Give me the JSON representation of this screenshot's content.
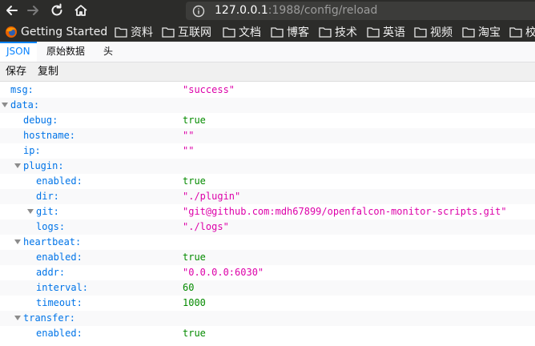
{
  "url": {
    "host": "127.0.0.1",
    "path": ":1988/config/reload"
  },
  "bookmarks": [
    {
      "label": "Getting Started",
      "icon": "firefox-icon"
    },
    {
      "label": "资料",
      "icon": "folder-icon"
    },
    {
      "label": "互联网",
      "icon": "folder-icon"
    },
    {
      "label": "文档",
      "icon": "folder-icon"
    },
    {
      "label": "博客",
      "icon": "folder-icon"
    },
    {
      "label": "技术",
      "icon": "folder-icon"
    },
    {
      "label": "英语",
      "icon": "folder-icon"
    },
    {
      "label": "视频",
      "icon": "folder-icon"
    },
    {
      "label": "淘宝",
      "icon": "folder-icon"
    },
    {
      "label": "校",
      "icon": "folder-icon"
    }
  ],
  "tabs": [
    {
      "label": "JSON",
      "active": true
    },
    {
      "label": "原始数据",
      "active": false
    },
    {
      "label": "头",
      "active": false
    }
  ],
  "toolbar": {
    "save": "保存",
    "copy": "复制"
  },
  "colors": {
    "key": "#0074e8",
    "string": "#dd00a9",
    "literal": "#058b00",
    "accent": "#0a84ff"
  },
  "rows": [
    {
      "key": "msg:",
      "value": "\"success\"",
      "type": "str",
      "depth": 0,
      "expander": false
    },
    {
      "key": "data:",
      "value": "",
      "type": "",
      "depth": 0,
      "expander": true
    },
    {
      "key": "debug:",
      "value": "true",
      "type": "bool",
      "depth": 1,
      "expander": false
    },
    {
      "key": "hostname:",
      "value": "\"\"",
      "type": "str",
      "depth": 1,
      "expander": false
    },
    {
      "key": "ip:",
      "value": "\"\"",
      "type": "str",
      "depth": 1,
      "expander": false
    },
    {
      "key": "plugin:",
      "value": "",
      "type": "",
      "depth": 1,
      "expander": true
    },
    {
      "key": "enabled:",
      "value": "true",
      "type": "bool",
      "depth": 2,
      "expander": false
    },
    {
      "key": "dir:",
      "value": "\"./plugin\"",
      "type": "str",
      "depth": 2,
      "expander": false
    },
    {
      "key": "git:",
      "value": "\"git@github.com:mdh67899/openfalcon-monitor-scripts.git\"",
      "type": "str",
      "depth": 2,
      "expander": true
    },
    {
      "key": "logs:",
      "value": "\"./logs\"",
      "type": "str",
      "depth": 2,
      "expander": false
    },
    {
      "key": "heartbeat:",
      "value": "",
      "type": "",
      "depth": 1,
      "expander": true
    },
    {
      "key": "enabled:",
      "value": "true",
      "type": "bool",
      "depth": 2,
      "expander": false
    },
    {
      "key": "addr:",
      "value": "\"0.0.0.0:6030\"",
      "type": "str",
      "depth": 2,
      "expander": false
    },
    {
      "key": "interval:",
      "value": "60",
      "type": "num",
      "depth": 2,
      "expander": false
    },
    {
      "key": "timeout:",
      "value": "1000",
      "type": "num",
      "depth": 2,
      "expander": false
    },
    {
      "key": "transfer:",
      "value": "",
      "type": "",
      "depth": 1,
      "expander": true
    },
    {
      "key": "enabled:",
      "value": "true",
      "type": "bool",
      "depth": 2,
      "expander": false
    }
  ]
}
